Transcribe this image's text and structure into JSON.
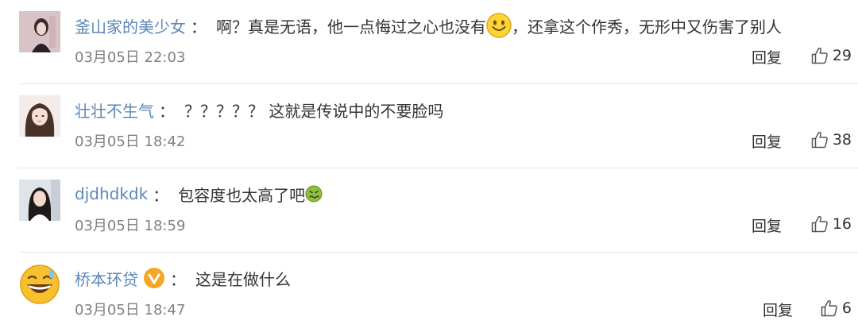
{
  "comments": [
    {
      "username": "釜山家的美少女",
      "text_before_emoji": "啊？真是无语，他一点悔过之心也没有",
      "emoji": "smile-emoji",
      "text_after_emoji": "，还拿这个作秀，无形中又伤害了别人",
      "time": "03月05日 22:03",
      "reply_label": "回复",
      "likes": "29"
    },
    {
      "username": "壮壮不生气",
      "text_before_emoji": "？？？？？ 这就是传说中的不要脸吗",
      "emoji": "",
      "text_after_emoji": "",
      "time": "03月05日 18:42",
      "reply_label": "回复",
      "likes": "38"
    },
    {
      "username": "djdhdkdk",
      "text_before_emoji": "包容度也太高了吧",
      "emoji": "nauseated-emoji",
      "text_after_emoji": "",
      "time": "03月05日 18:59",
      "reply_label": "回复",
      "likes": "16"
    },
    {
      "username": "桥本环贷",
      "verified_badge": "verified-v-icon",
      "text_before_emoji": "这是在做什么",
      "emoji": "",
      "text_after_emoji": "",
      "time": "03月05日 18:47",
      "reply_label": "回复",
      "likes": "6"
    }
  ],
  "colors": {
    "username": "#5d86b7",
    "text": "#333333",
    "time": "#808080",
    "divider": "#e8e8e8",
    "verified_badge": "#f5a623"
  }
}
